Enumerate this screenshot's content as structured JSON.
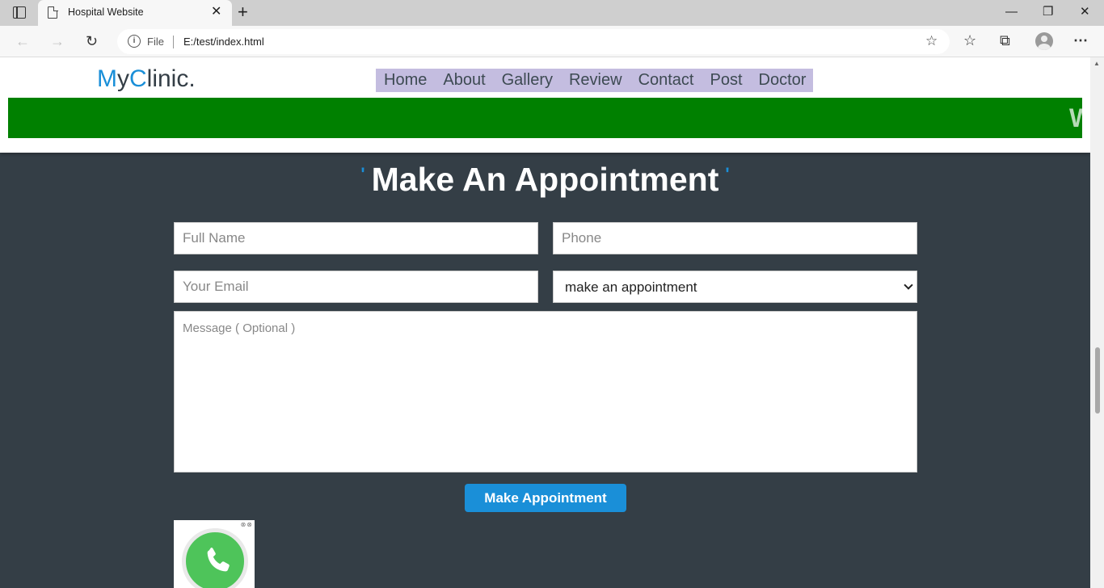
{
  "browser": {
    "tab_title": "Hospital Website",
    "omnibox_scheme": "File",
    "omnibox_url": "E:/test/index.html",
    "window_buttons": [
      "—",
      "❐",
      "✕"
    ]
  },
  "site": {
    "logo": {
      "m": "M",
      "y": "y",
      "c": "C",
      "rest": "linic."
    },
    "nav": [
      "Home",
      "About",
      "Gallery",
      "Review",
      "Contact",
      "Post",
      "Doctor"
    ],
    "marquee_text": "W",
    "colors": {
      "accent": "#1a8fd8",
      "dark": "#343e46",
      "marquee": "#008000",
      "nav_bg": "#c4bde0"
    }
  },
  "appointment": {
    "quote_left": "'",
    "heading": "Make An Appointment",
    "quote_right": "'",
    "full_name_placeholder": "Full Name",
    "phone_placeholder": "Phone",
    "email_placeholder": "Your Email",
    "select_value": "make an appointment",
    "message_placeholder": "Message ( Optional )",
    "submit_label": "Make Appointment"
  },
  "widget": {
    "icon": "whatsapp-icon"
  }
}
